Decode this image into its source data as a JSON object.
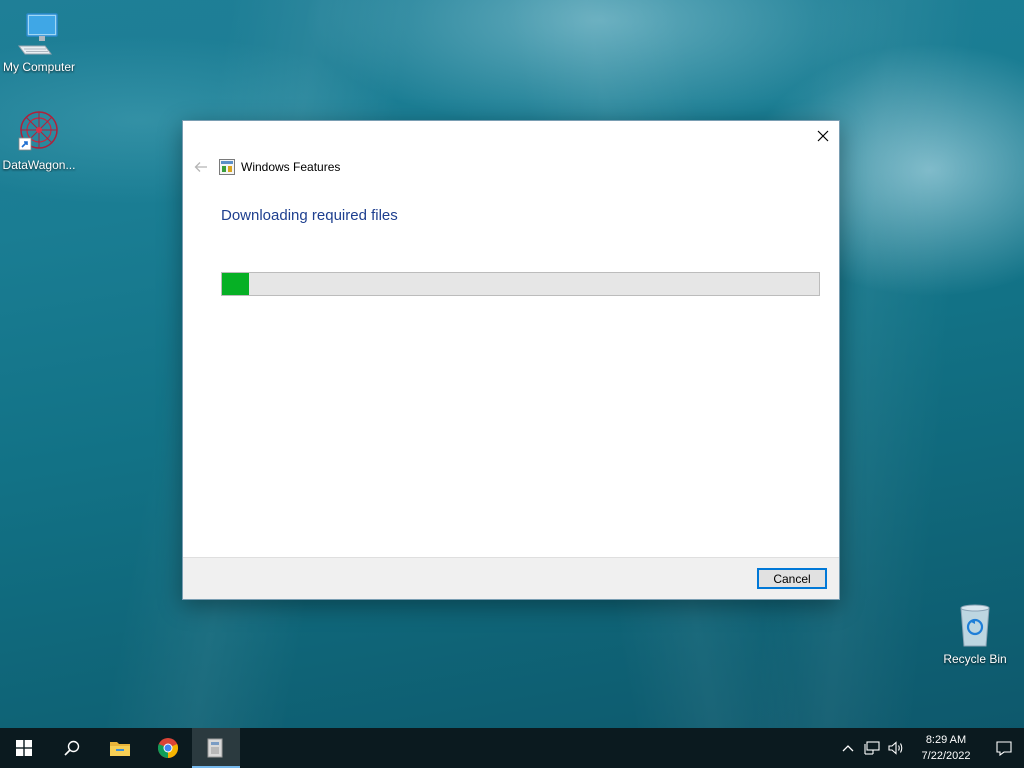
{
  "desktop": {
    "icons": [
      {
        "label": "My Computer"
      },
      {
        "label": "DataWagon..."
      },
      {
        "label": "Recycle Bin"
      }
    ]
  },
  "dialog": {
    "title": "Windows Features",
    "heading": "Downloading required files",
    "progress_fraction": 0.045,
    "cancel_label": "Cancel"
  },
  "taskbar": {
    "apps": [
      {
        "icon": "windows-start-icon"
      },
      {
        "icon": "search-icon"
      },
      {
        "icon": "file-explorer-icon"
      },
      {
        "icon": "chrome-icon"
      },
      {
        "icon": "windows-features-icon",
        "active": true
      }
    ],
    "clock": {
      "time": "8:29 AM",
      "date": "7/22/2022"
    }
  },
  "colors": {
    "accent": "#0078d7",
    "progress_fill": "#06b025",
    "heading_text": "#1e3f8f"
  }
}
